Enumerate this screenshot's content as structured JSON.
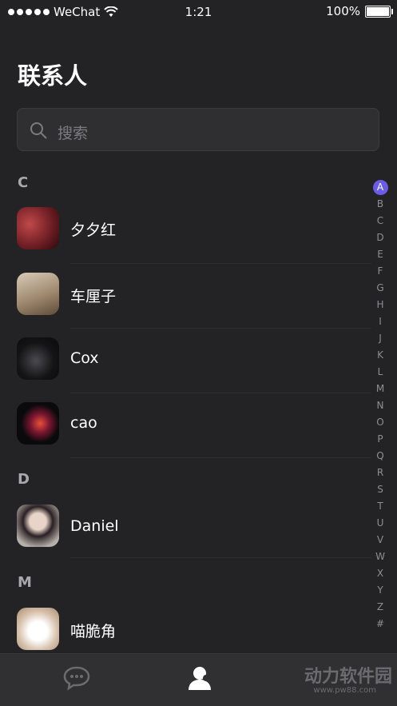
{
  "status": {
    "carrier": "WeChat",
    "time": "1:21",
    "battery": "100%"
  },
  "page": {
    "title": "联系人"
  },
  "search": {
    "placeholder": "搜索"
  },
  "sections": [
    {
      "letter": "C",
      "contacts": [
        {
          "name": "夕夕红",
          "avatar": "red-abstract-photo"
        },
        {
          "name": "车厘子",
          "avatar": "cat-photo"
        },
        {
          "name": "Cox",
          "avatar": "dark-cat-photo"
        },
        {
          "name": "cao",
          "avatar": "phone-glow-photo"
        }
      ]
    },
    {
      "letter": "D",
      "contacts": [
        {
          "name": "Daniel",
          "avatar": "woman-portrait-photo"
        }
      ]
    },
    {
      "letter": "M",
      "contacts": [
        {
          "name": "喵脆角",
          "avatar": "white-cat-photo"
        }
      ]
    }
  ],
  "index": {
    "letters": [
      "A",
      "B",
      "C",
      "D",
      "E",
      "F",
      "G",
      "H",
      "I",
      "J",
      "K",
      "L",
      "M",
      "N",
      "O",
      "P",
      "Q",
      "R",
      "S",
      "T",
      "U",
      "V",
      "W",
      "X",
      "Y",
      "Z",
      "#"
    ],
    "active": "A"
  },
  "tabs": [
    {
      "icon": "chat-bubble-icon",
      "active": false
    },
    {
      "icon": "contacts-icon",
      "active": true
    }
  ],
  "watermark": {
    "text": "动力软件园",
    "url": "www.pw88.com"
  },
  "colors": {
    "background": "#232325",
    "accent": "#6a5de1",
    "tab_bar": "#303033"
  }
}
